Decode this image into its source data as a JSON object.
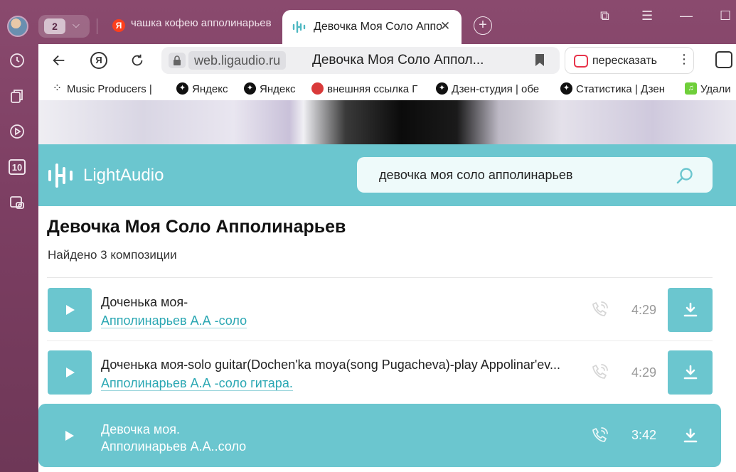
{
  "browser": {
    "tab_count": "2",
    "tabs": [
      {
        "title": "чашка кофею апполинарьев"
      },
      {
        "title": "Девочка Моя Соло Апполинарьев"
      }
    ],
    "address": {
      "domain": "web.ligaudio.ru",
      "page_title": "Девочка Моя Соло Аппол..."
    },
    "retell_label": "пересказать",
    "bookmarks": [
      {
        "label": "Music Producers |",
        "icon": "dots-icon"
      },
      {
        "label": "Яндекс",
        "icon": "star-icon"
      },
      {
        "label": "Яндекс",
        "icon": "star-icon"
      },
      {
        "label": "внешняя ссылка Г",
        "icon": "umbrella-icon"
      },
      {
        "label": "Дзен-студия | обе",
        "icon": "star-icon"
      },
      {
        "label": "Статистика | Дзен",
        "icon": "star-icon"
      },
      {
        "label": "Удали",
        "icon": "music-icon"
      }
    ],
    "sidebar_badge": "10"
  },
  "site": {
    "logo_text": "LightAudio",
    "search_query": "девочка моя соло апполинарьев",
    "page_title": "Девочка Моя Соло Апполинарьев",
    "found_text": "Найдено 3 композиции",
    "accent_color": "#6bc6cf",
    "link_color": "#2aa7b3"
  },
  "tracks": [
    {
      "name": "Доченька моя-",
      "artist": "Апполинарьев А.А -соло",
      "duration": "4:29"
    },
    {
      "name": "Доченька моя-solo guitar(Dochen'ka moya(song Pugacheva)-play Appolinar'ev...",
      "artist": "Апполинарьев А.А -соло гитара.",
      "duration": "4:29"
    },
    {
      "name": "Девочка моя.",
      "artist": "Апполинарьев А.А..соло",
      "duration": "3:42"
    }
  ]
}
